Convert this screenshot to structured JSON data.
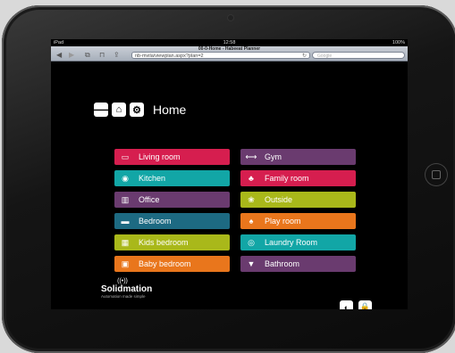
{
  "status": {
    "device": "iPad",
    "time": "12:58",
    "battery": "100%"
  },
  "browser": {
    "page_title": "00-0-Home - Habeeat Planner",
    "address": "nb-mvila/viewplan.aspx?plan=2",
    "search_placeholder": "Google"
  },
  "app": {
    "title": "Home",
    "rooms": [
      {
        "label": "Living room",
        "color": "#d61e4f",
        "icon": "sofa-icon"
      },
      {
        "label": "Kitchen",
        "color": "#12a6a6",
        "icon": "stove-icon"
      },
      {
        "label": "Office",
        "color": "#6a3b6f",
        "icon": "bookshelf-icon"
      },
      {
        "label": "Bedroom",
        "color": "#1d6a82",
        "icon": "bed-icon"
      },
      {
        "label": "Kids bedroom",
        "color": "#a9b81a",
        "icon": "crib-icon"
      },
      {
        "label": "Baby bedroom",
        "color": "#e9761c",
        "icon": "cot-icon"
      },
      {
        "label": "Gym",
        "color": "#6a3b6f",
        "icon": "dumbbell-icon"
      },
      {
        "label": "Family room",
        "color": "#d61e4f",
        "icon": "family-icon"
      },
      {
        "label": "Outside",
        "color": "#a9b81a",
        "icon": "tree-icon"
      },
      {
        "label": "Play room",
        "color": "#e9761c",
        "icon": "game-icon"
      },
      {
        "label": "Laundry Room",
        "color": "#12a6a6",
        "icon": "washer-icon"
      },
      {
        "label": "Bathroom",
        "color": "#6a3b6f",
        "icon": "toilet-icon"
      }
    ],
    "logo_name": "Solidmation",
    "logo_tagline": "Automation made simple"
  }
}
